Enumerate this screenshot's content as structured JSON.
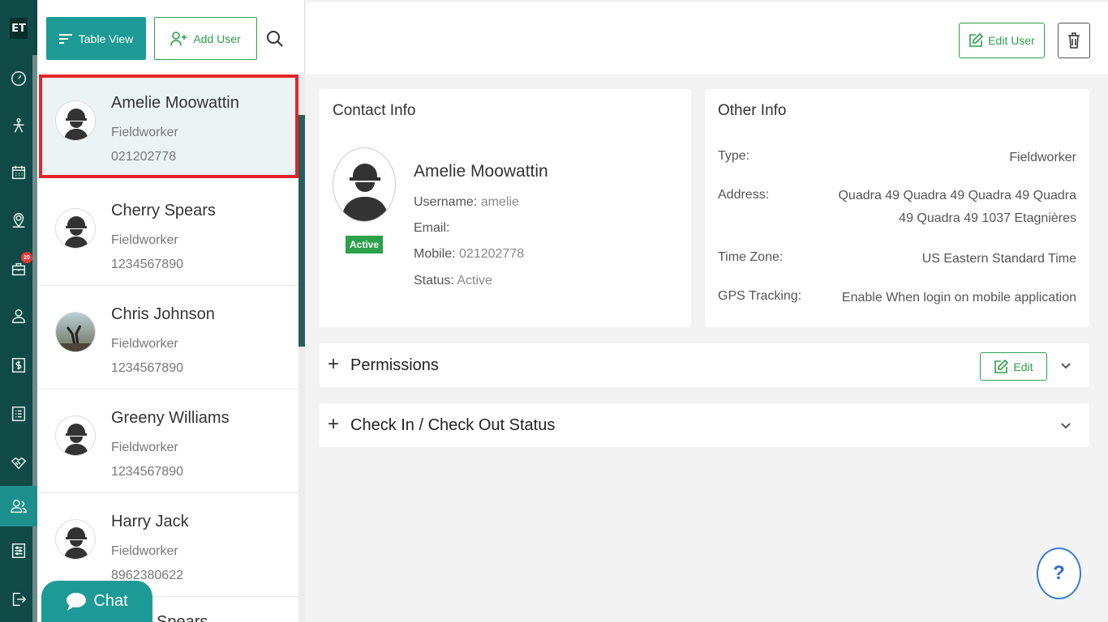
{
  "app": {
    "logo": "ET",
    "notification_count": "20"
  },
  "rail": {
    "items": [
      {
        "name": "dashboard-icon"
      },
      {
        "name": "routing-icon"
      },
      {
        "name": "calendar-icon"
      },
      {
        "name": "map-pin-icon"
      },
      {
        "name": "jobs-icon"
      },
      {
        "name": "customer-icon"
      },
      {
        "name": "invoice-icon"
      },
      {
        "name": "list-icon"
      },
      {
        "name": "handshake-icon"
      },
      {
        "name": "users-icon"
      },
      {
        "name": "settings-icon"
      },
      {
        "name": "logout-icon"
      }
    ],
    "active": "users-icon"
  },
  "toolbar": {
    "table_view_label": "Table View",
    "add_user_label": "Add User"
  },
  "users": [
    {
      "name": "Amelie Moowattin",
      "role": "Fieldworker",
      "phone": "021202778"
    },
    {
      "name": "Cherry Spears",
      "role": "Fieldworker",
      "phone": "1234567890"
    },
    {
      "name": "Chris Johnson",
      "role": "Fieldworker",
      "phone": "1234567890"
    },
    {
      "name": "Greeny Williams",
      "role": "Fieldworker",
      "phone": "1234567890"
    },
    {
      "name": "Harry Jack",
      "role": "Fieldworker",
      "phone": "8962380622"
    },
    {
      "name": "Spears",
      "role": "",
      "phone": ""
    }
  ],
  "chat": {
    "label": "Chat"
  },
  "header": {
    "edit_user_label": "Edit User"
  },
  "contact": {
    "title": "Contact Info",
    "name": "Amelie Moowattin",
    "badge": "Active",
    "username_label": "Username:",
    "username": "amelie",
    "email_label": "Email:",
    "email": "",
    "mobile_label": "Mobile:",
    "mobile": "021202778",
    "status_label": "Status:",
    "status": "Active"
  },
  "other": {
    "title": "Other Info",
    "type_label": "Type:",
    "type": "Fieldworker",
    "address_label": "Address:",
    "address": "Quadra 49 Quadra 49 Quadra 49 Quadra 49 Quadra 49 1037 Etagnières",
    "timezone_label": "Time Zone:",
    "timezone": "US Eastern Standard Time",
    "gps_label": "GPS Tracking:",
    "gps": "Enable When login on mobile application"
  },
  "permissions": {
    "title": "Permissions",
    "edit_label": "Edit"
  },
  "checkin": {
    "title": "Check In / Check Out Status"
  },
  "help": {
    "label": "?"
  }
}
